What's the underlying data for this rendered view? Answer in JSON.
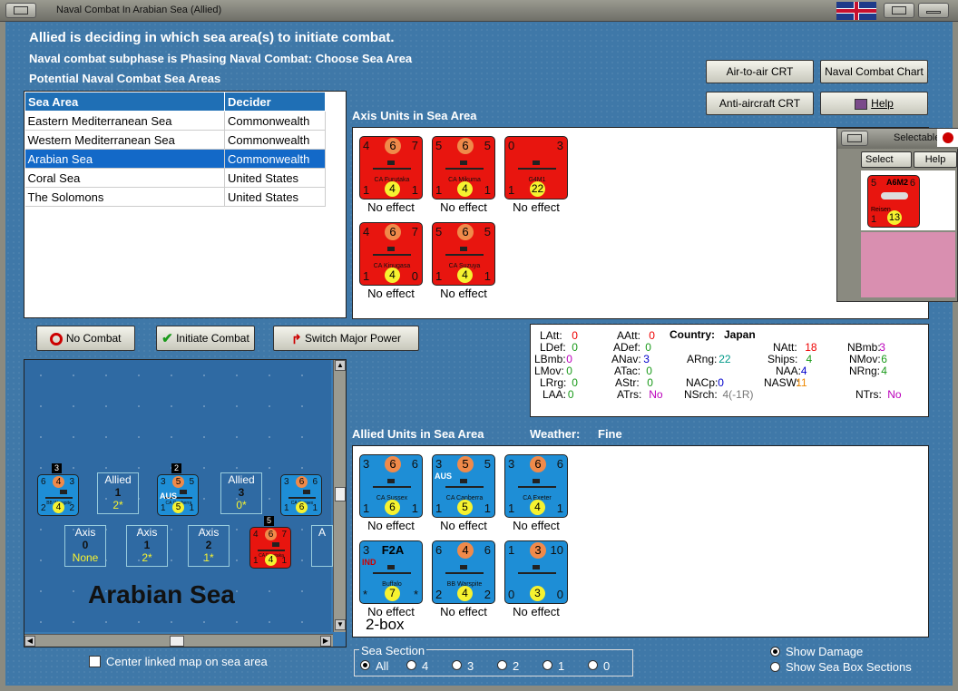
{
  "window": {
    "title": "Naval Combat In Arabian Sea (Allied)"
  },
  "header": {
    "line1": "Allied is deciding in which sea area(s) to initiate combat.",
    "line2": "Naval combat subphase is Phasing Naval Combat: Choose Sea Area",
    "line3": "Potential Naval Combat Sea Areas"
  },
  "top_buttons": {
    "air_crt": "Air-to-air CRT",
    "naval_chart": "Naval Combat Chart",
    "aa_crt": "Anti-aircraft CRT",
    "help": "Help"
  },
  "sea_table": {
    "headers": [
      "Sea Area",
      "Decider"
    ],
    "rows": [
      [
        "Eastern Mediterranean Sea",
        "Commonwealth"
      ],
      [
        "Western Mediterranean Sea",
        "Commonwealth"
      ],
      [
        "Arabian Sea",
        "Commonwealth"
      ],
      [
        "Coral Sea",
        "United States"
      ],
      [
        "The Solomons",
        "United States"
      ]
    ],
    "selected_index": 2
  },
  "axis_section": {
    "label": "Axis Units in Sea Area"
  },
  "axis_units": [
    {
      "name": "CA Furutaka",
      "tl": "4",
      "tc": "6",
      "tr": "7",
      "bl": "1",
      "bc": "4",
      "br": "1",
      "effect": "No effect"
    },
    {
      "name": "CA Mikuma",
      "tl": "5",
      "tc": "6",
      "tr": "5",
      "bl": "1",
      "bc": "4",
      "br": "1",
      "effect": "No effect"
    },
    {
      "name": "G4M1",
      "tl": "0",
      "tc": "",
      "tr": "3",
      "bl": "1",
      "bc": "22",
      "br": "",
      "effect": "No effect"
    },
    {
      "name": "CA Kinugasa",
      "tl": "4",
      "tc": "6",
      "tr": "7",
      "bl": "1",
      "bc": "4",
      "br": "0",
      "effect": "No effect"
    },
    {
      "name": "CA Suzuya",
      "tl": "5",
      "tc": "6",
      "tr": "5",
      "bl": "1",
      "bc": "4",
      "br": "1",
      "effect": "No effect"
    }
  ],
  "selectable": {
    "title": "Selectable",
    "select": "Select",
    "help": "Help",
    "unit_name": "A6M2",
    "unit_sub": "Reisen",
    "tl": "5",
    "tr": "6",
    "bl": "1",
    "bc": "13"
  },
  "action_buttons": {
    "no_combat": "No Combat",
    "initiate": "Initiate Combat",
    "switch": "Switch Major Power"
  },
  "stats": {
    "country_label": "Country:",
    "country": "Japan",
    "LAtt": "0",
    "LDef": "0",
    "LBmb": "0",
    "LMov": "0",
    "LRrg": "0",
    "LAA": "0",
    "AAtt": "0",
    "ADef": "0",
    "ANav": "3",
    "ATac": "0",
    "AStr": "0",
    "ATrs": "No",
    "ARng": "22",
    "NACp": "0",
    "NSrch": "4(-1R)",
    "NAtt": "18",
    "Ships": "4",
    "NAA": "4",
    "NASW": "11",
    "NBmb": "3",
    "NMov": "6",
    "NRng": "4",
    "NTrs": "No"
  },
  "allied_section": {
    "label": "Allied Units in Sea Area",
    "weather_label": "Weather:",
    "weather": "Fine"
  },
  "allied_units": [
    {
      "name": "CA Sussex",
      "tl": "3",
      "tc": "6",
      "tr": "6",
      "bl": "1",
      "bc": "6",
      "br": "1",
      "effect": "No effect"
    },
    {
      "name": "CA Canberra",
      "tl": "3",
      "tc": "5",
      "tr": "5",
      "bl": "1",
      "bc": "5",
      "br": "1",
      "effect": "No effect",
      "tag": "AUS"
    },
    {
      "name": "CA Exeter",
      "tl": "3",
      "tc": "6",
      "tr": "6",
      "bl": "1",
      "bc": "4",
      "br": "1",
      "effect": "No effect"
    },
    {
      "name": "Buffalo",
      "tl": "3",
      "tc": "F2A",
      "tr": "",
      "bl": "*",
      "bc": "7",
      "br": "*",
      "effect": "No effect",
      "tag": "IND"
    },
    {
      "name": "BB Warspite",
      "tl": "6",
      "tc": "4",
      "tr": "6",
      "bl": "2",
      "bc": "4",
      "br": "2",
      "effect": "No effect"
    },
    {
      "name": "",
      "tl": "1",
      "tc": "3",
      "tr": "10",
      "bl": "0",
      "bc": "3",
      "br": "0",
      "effect": "No effect"
    }
  ],
  "box_label": "2-box",
  "map": {
    "sea_name": "Arabian Sea",
    "allied_boxes": [
      {
        "label": "Allied",
        "num": "1",
        "val": "2*"
      },
      {
        "label": "Allied",
        "num": "3",
        "val": "0*"
      }
    ],
    "axis_boxes": [
      {
        "label": "Axis",
        "num": "0",
        "val": "None"
      },
      {
        "label": "Axis",
        "num": "1",
        "val": "2*"
      },
      {
        "label": "Axis",
        "num": "2",
        "val": "1*"
      },
      {
        "label": "A"
      }
    ],
    "counters": [
      {
        "name": "BB Warspite",
        "tl": "6",
        "tc": "4",
        "tr": "3",
        "bl": "2",
        "bc": "4",
        "br": "2",
        "badge": "3"
      },
      {
        "name": "CA Canberra",
        "tl": "3",
        "tc": "5",
        "tr": "5",
        "bl": "1",
        "bc": "5",
        "br": "1",
        "badge": "2",
        "tag": "AUS"
      },
      {
        "name": "CA Sussex",
        "tl": "3",
        "tc": "6",
        "tr": "6",
        "bl": "1",
        "bc": "6",
        "br": "1"
      },
      {
        "name": "CA Furutaka",
        "tl": "4",
        "tc": "6",
        "tr": "7",
        "bl": "1",
        "bc": "4",
        "br": "1",
        "badge": "5"
      }
    ]
  },
  "center_check": "Center linked map on sea area",
  "sea_section": {
    "title": "Sea Section",
    "options": [
      "All",
      "4",
      "3",
      "2",
      "1",
      "0"
    ],
    "selected": "All"
  },
  "display": {
    "show_damage": "Show Damage",
    "show_sections": "Show Sea Box Sections"
  },
  "colors": {
    "axis_red": "#e8150f",
    "allied_blue": "#1e8ed6",
    "select_blue": "#1369c8"
  }
}
